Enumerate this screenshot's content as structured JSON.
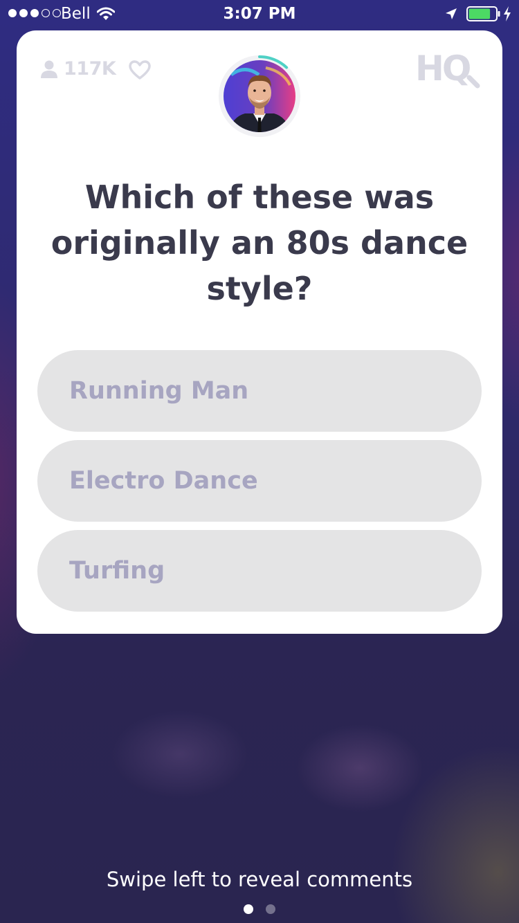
{
  "status_bar": {
    "signal_bars_filled": 3,
    "signal_bars_total": 5,
    "carrier": "Bell",
    "time": "3:07 PM",
    "battery_level_fraction": 0.85,
    "charging": true
  },
  "header": {
    "viewer_count": "117K",
    "logo_text": "HQ"
  },
  "host": {
    "countdown_progress_fraction": 0.12
  },
  "question": {
    "text": "Which of these was originally an 80s dance style?"
  },
  "answers": [
    {
      "label": "Running Man"
    },
    {
      "label": "Electro Dance"
    },
    {
      "label": "Turfing"
    }
  ],
  "footer": {
    "swipe_hint": "Swipe left to reveal comments",
    "page_count": 2,
    "active_page": 1
  },
  "colors": {
    "accent_teal": "#4fd1c5",
    "answer_background": "#e4e4e5",
    "answer_text": "#a7a5c1",
    "question_text": "#3a3a4c",
    "muted_icon": "#d8d8e2",
    "battery_green": "#4cd964"
  }
}
